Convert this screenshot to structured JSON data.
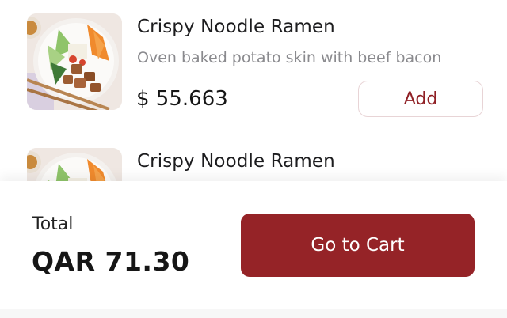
{
  "items": [
    {
      "title": "Crispy Noodle Ramen",
      "description": "Oven baked potato skin with beef bacon",
      "price": "$ 55.663",
      "add_label": "Add",
      "image_icon": "ramen-bowl-image"
    },
    {
      "title": "Crispy Noodle Ramen",
      "image_icon": "ramen-bowl-image"
    }
  ],
  "footer": {
    "total_label": "Total",
    "total_amount": "QAR 71.30",
    "cart_label": "Go to Cart"
  },
  "colors": {
    "accent": "#952327",
    "add_text": "#8f1f24",
    "muted_text": "#8a8a8e"
  }
}
